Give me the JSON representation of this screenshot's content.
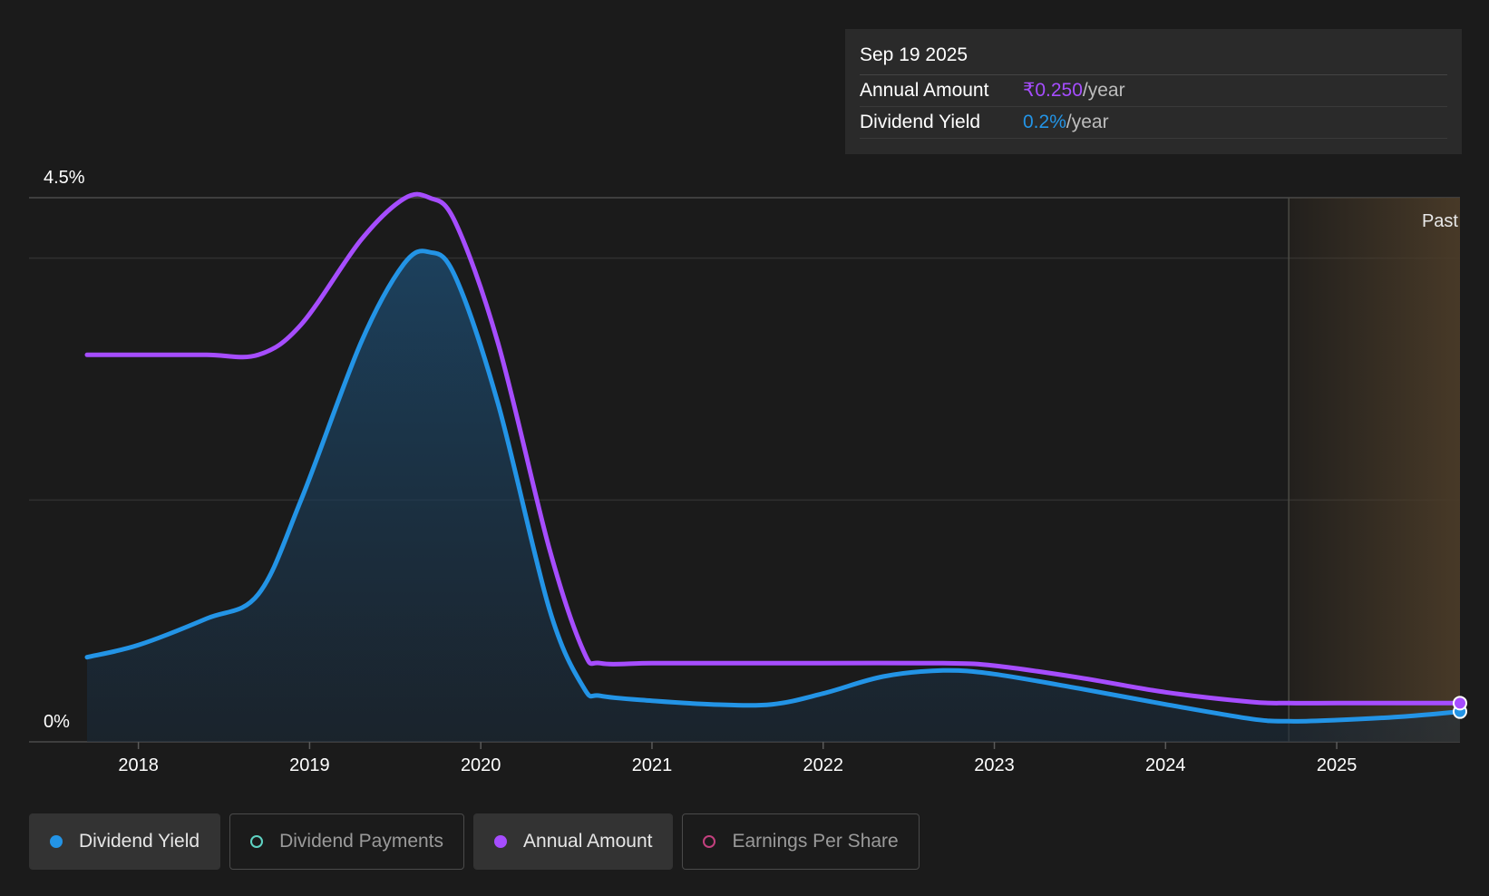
{
  "tooltip": {
    "date": "Sep 19 2025",
    "rows": [
      {
        "label": "Annual Amount",
        "value": "₹0.250",
        "suffix": "/year",
        "color": "#a64dff"
      },
      {
        "label": "Dividend Yield",
        "value": "0.2%",
        "suffix": "/year",
        "color": "#2394e6"
      }
    ]
  },
  "legend": [
    {
      "label": "Dividend Yield",
      "active": true,
      "filled": true,
      "color": "#2394e6"
    },
    {
      "label": "Dividend Payments",
      "active": false,
      "filled": false,
      "color": "#5fd3c3"
    },
    {
      "label": "Annual Amount",
      "active": true,
      "filled": true,
      "color": "#a64dff"
    },
    {
      "label": "Earnings Per Share",
      "active": false,
      "filled": false,
      "color": "#c2407e"
    }
  ],
  "chart_data": {
    "type": "line",
    "x_range": [
      2017.7,
      2025.72
    ],
    "ylim": [
      0,
      4.5
    ],
    "y_ticks": [
      {
        "value": 4.5,
        "label": "4.5%"
      },
      {
        "value": 0,
        "label": "0%"
      }
    ],
    "x_ticks": [
      2018,
      2019,
      2020,
      2021,
      2022,
      2023,
      2024,
      2025
    ],
    "x_tick_labels": [
      "2018",
      "2019",
      "2020",
      "2021",
      "2022",
      "2023",
      "2024",
      "2025"
    ],
    "past_region": {
      "start": 2024.72,
      "label": "Past"
    },
    "series": [
      {
        "name": "Dividend Yield",
        "color": "#2394e6",
        "fill": true,
        "points": [
          [
            2017.7,
            0.7
          ],
          [
            2018.0,
            0.8
          ],
          [
            2018.4,
            1.02
          ],
          [
            2018.7,
            1.22
          ],
          [
            2018.95,
            2.0
          ],
          [
            2019.3,
            3.3
          ],
          [
            2019.55,
            3.95
          ],
          [
            2019.7,
            4.05
          ],
          [
            2019.85,
            3.85
          ],
          [
            2020.1,
            2.8
          ],
          [
            2020.4,
            1.1
          ],
          [
            2020.6,
            0.45
          ],
          [
            2020.7,
            0.38
          ],
          [
            2021.0,
            0.34
          ],
          [
            2021.35,
            0.31
          ],
          [
            2021.7,
            0.31
          ],
          [
            2022.0,
            0.4
          ],
          [
            2022.35,
            0.54
          ],
          [
            2022.7,
            0.59
          ],
          [
            2023.0,
            0.56
          ],
          [
            2023.5,
            0.44
          ],
          [
            2024.0,
            0.31
          ],
          [
            2024.5,
            0.19
          ],
          [
            2024.72,
            0.17
          ],
          [
            2025.0,
            0.18
          ],
          [
            2025.4,
            0.21
          ],
          [
            2025.72,
            0.25
          ]
        ]
      },
      {
        "name": "Annual Amount",
        "color": "#a64dff",
        "fill": false,
        "points": [
          [
            2017.7,
            3.2
          ],
          [
            2018.0,
            3.2
          ],
          [
            2018.4,
            3.2
          ],
          [
            2018.7,
            3.2
          ],
          [
            2018.95,
            3.45
          ],
          [
            2019.3,
            4.15
          ],
          [
            2019.55,
            4.49
          ],
          [
            2019.7,
            4.5
          ],
          [
            2019.85,
            4.3
          ],
          [
            2020.1,
            3.3
          ],
          [
            2020.4,
            1.6
          ],
          [
            2020.6,
            0.75
          ],
          [
            2020.7,
            0.65
          ],
          [
            2021.0,
            0.65
          ],
          [
            2021.5,
            0.65
          ],
          [
            2022.0,
            0.65
          ],
          [
            2022.7,
            0.65
          ],
          [
            2023.0,
            0.63
          ],
          [
            2023.5,
            0.53
          ],
          [
            2024.0,
            0.41
          ],
          [
            2024.5,
            0.33
          ],
          [
            2024.72,
            0.32
          ],
          [
            2025.0,
            0.32
          ],
          [
            2025.4,
            0.32
          ],
          [
            2025.72,
            0.32
          ]
        ]
      }
    ]
  }
}
